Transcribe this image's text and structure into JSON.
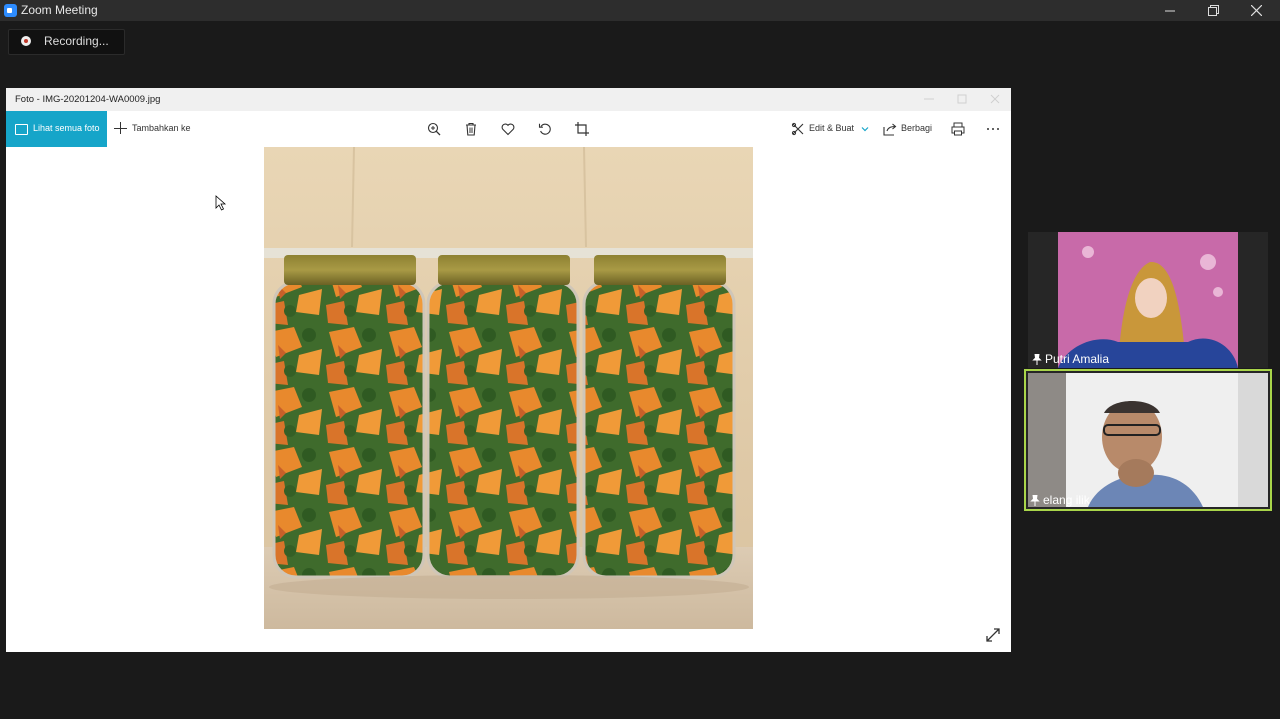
{
  "window": {
    "title": "Zoom Meeting"
  },
  "recording": {
    "label": "Recording..."
  },
  "photos_app": {
    "title": "Foto - IMG-20201204-WA0009.jpg",
    "see_all_label": "Lihat semua foto",
    "add_to_label": "Tambahkan ke",
    "edit_create_label": "Edit & Buat",
    "share_label": "Berbagi",
    "accent_color": "#16a5c9"
  },
  "participants": [
    {
      "name": "Putri Amalia",
      "pinned": true,
      "speaking": false
    },
    {
      "name": "elang ilik",
      "pinned": true,
      "speaking": true
    }
  ],
  "icons": [
    "zoom-logo-icon",
    "minimize-icon",
    "restore-icon",
    "close-icon",
    "record-icon",
    "photos-icon",
    "plus-icon",
    "zoom-in-icon",
    "trash-icon",
    "heart-icon",
    "rotate-icon",
    "crop-icon",
    "edit-icon",
    "share-icon",
    "print-icon",
    "more-icon",
    "expand-icon",
    "pin-icon"
  ]
}
